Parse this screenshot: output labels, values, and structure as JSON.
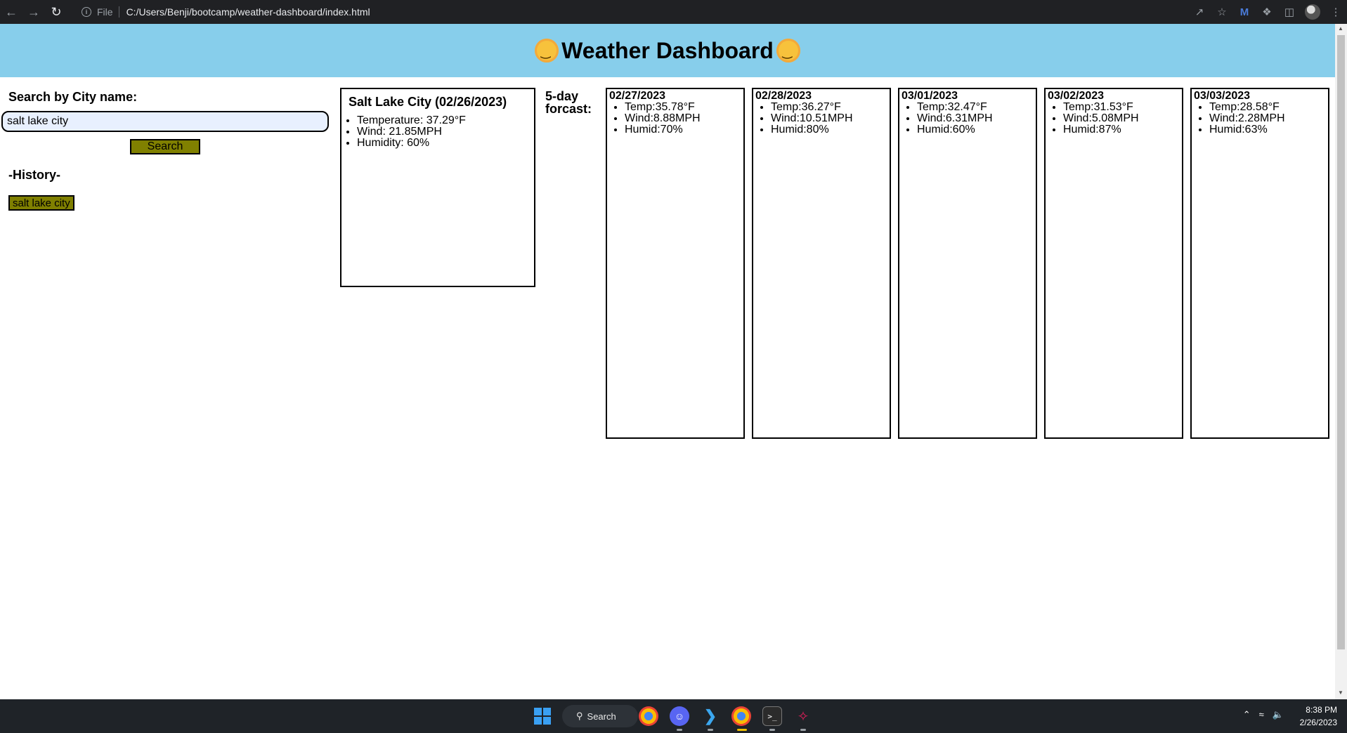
{
  "browser": {
    "file_label": "File",
    "url": "C:/Users/Benji/bootcamp/weather-dashboard/index.html"
  },
  "header": {
    "title": "Weather Dashboard"
  },
  "search": {
    "label": "Search by City name:",
    "value": "salt lake city",
    "button_label": "Search"
  },
  "history": {
    "label": "-History-",
    "items": [
      "salt lake city"
    ]
  },
  "current": {
    "title": "Salt Lake City (02/26/2023)",
    "temperature": "Temperature: 37.29°F",
    "wind": "Wind: 21.85MPH",
    "humidity": "Humidity: 60%"
  },
  "forecast": {
    "label": "5-day forcast:",
    "days": [
      {
        "date": "02/27/2023",
        "temp": "Temp:35.78°F",
        "wind": "Wind:8.88MPH",
        "humid": "Humid:70%"
      },
      {
        "date": "02/28/2023",
        "temp": "Temp:36.27°F",
        "wind": "Wind:10.51MPH",
        "humid": "Humid:80%"
      },
      {
        "date": "03/01/2023",
        "temp": "Temp:32.47°F",
        "wind": "Wind:6.31MPH",
        "humid": "Humid:60%"
      },
      {
        "date": "03/02/2023",
        "temp": "Temp:31.53°F",
        "wind": "Wind:5.08MPH",
        "humid": "Humid:87%"
      },
      {
        "date": "03/03/2023",
        "temp": "Temp:28.58°F",
        "wind": "Wind:2.28MPH",
        "humid": "Humid:63%"
      }
    ]
  },
  "taskbar": {
    "search_label": "Search",
    "time": "8:38 PM",
    "date": "2/26/2023"
  },
  "colors": {
    "header_bg": "#87ceeb",
    "button_bg": "#808000",
    "input_bg": "#e8f0fe"
  }
}
